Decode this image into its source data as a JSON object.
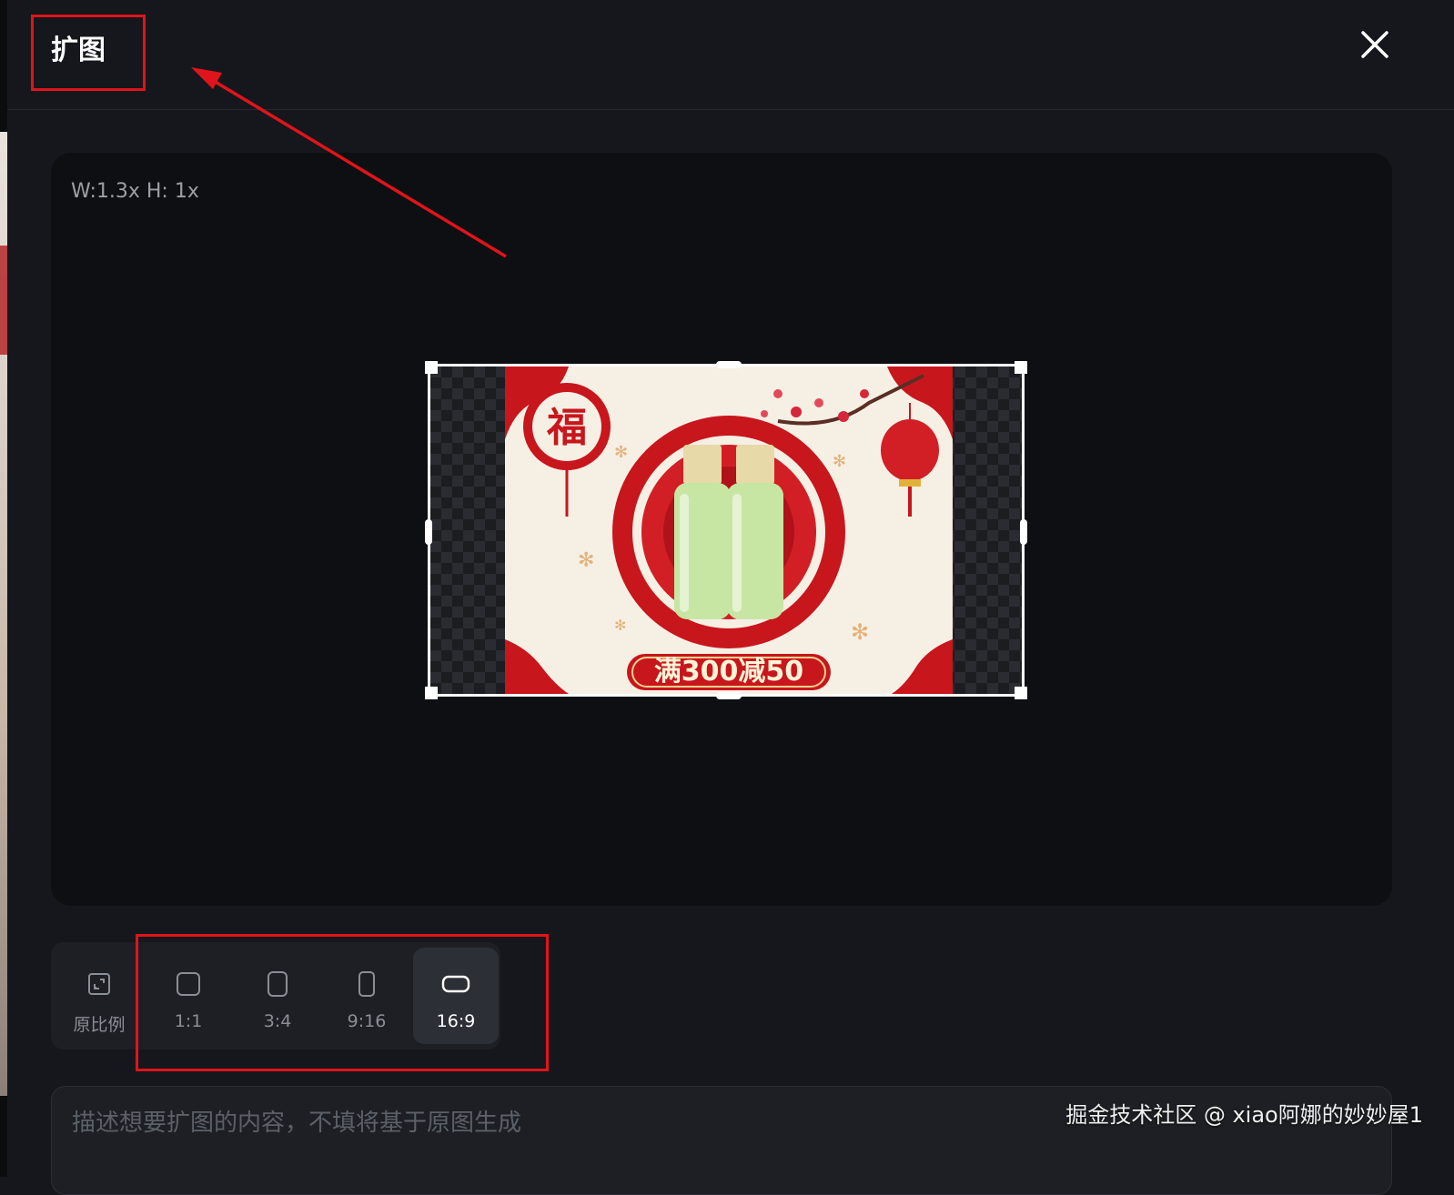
{
  "dialog": {
    "title": "扩图",
    "close_icon": "close-icon"
  },
  "canvas": {
    "scale_info": "W:1.3x H: 1x",
    "image": {
      "promo_text": "满300减50",
      "badge_char": "福"
    }
  },
  "ratio_options": [
    {
      "label": "原比例",
      "icon": "original-ratio-icon",
      "active": false
    },
    {
      "label": "1:1",
      "icon": "square-icon",
      "active": false
    },
    {
      "label": "3:4",
      "icon": "portrait-3-4-icon",
      "active": false
    },
    {
      "label": "9:16",
      "icon": "portrait-9-16-icon",
      "active": false
    },
    {
      "label": "16:9",
      "icon": "landscape-16-9-icon",
      "active": true
    }
  ],
  "prompt": {
    "placeholder": "描述想要扩图的内容，不填将基于原图生成",
    "value": ""
  },
  "watermark": "掘金技术社区 @ xiao阿娜的妙妙屋1",
  "colors": {
    "background": "#15171c",
    "canvas": "#0e0f12",
    "annotation_red": "#e0141b",
    "active_option": "#2c2f36"
  }
}
